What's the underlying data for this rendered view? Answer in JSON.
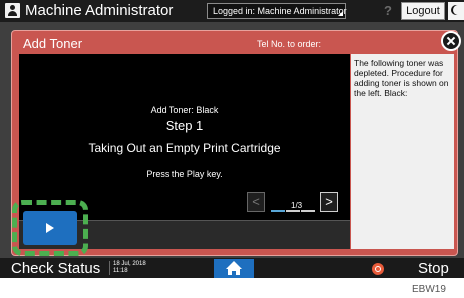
{
  "topbar": {
    "user_icon": "user-icon",
    "user_name": "Machine Administrator",
    "login_status": "Logged in: Machine Administrator",
    "help_icon": "help-icon",
    "help_label": "?",
    "logout_label": "Logout",
    "energy_icon": "moon-icon"
  },
  "dialog": {
    "title": "Add Toner",
    "tel_text": "Tel No. to order:",
    "close_icon": "close-icon",
    "video": {
      "subtitle": "Add Toner: Black",
      "step": "Step 1",
      "step_title": "Taking Out an Empty Print Cartridge",
      "instruction": "Press the Play key."
    },
    "controls": {
      "play_icon": "play-icon",
      "prev_label": "<",
      "next_label": ">",
      "page_indicator": "1/3",
      "current_page": 1,
      "total_pages": 3
    },
    "info_text": "The following toner was depleted. Procedure for adding toner is shown on the left. Black:"
  },
  "bottombar": {
    "check_status_label": "Check Status",
    "date": "18 Jul, 2018",
    "time": "11:18",
    "home_icon": "home-icon",
    "stop_icon": "stop-icon",
    "stop_label": "Stop"
  },
  "figure_id": "EBW19",
  "colors": {
    "dialog_red": "#c95650",
    "accent_blue": "#1e6fbf",
    "highlight_green": "#4caf50",
    "progress_blue": "#59a8d8"
  }
}
